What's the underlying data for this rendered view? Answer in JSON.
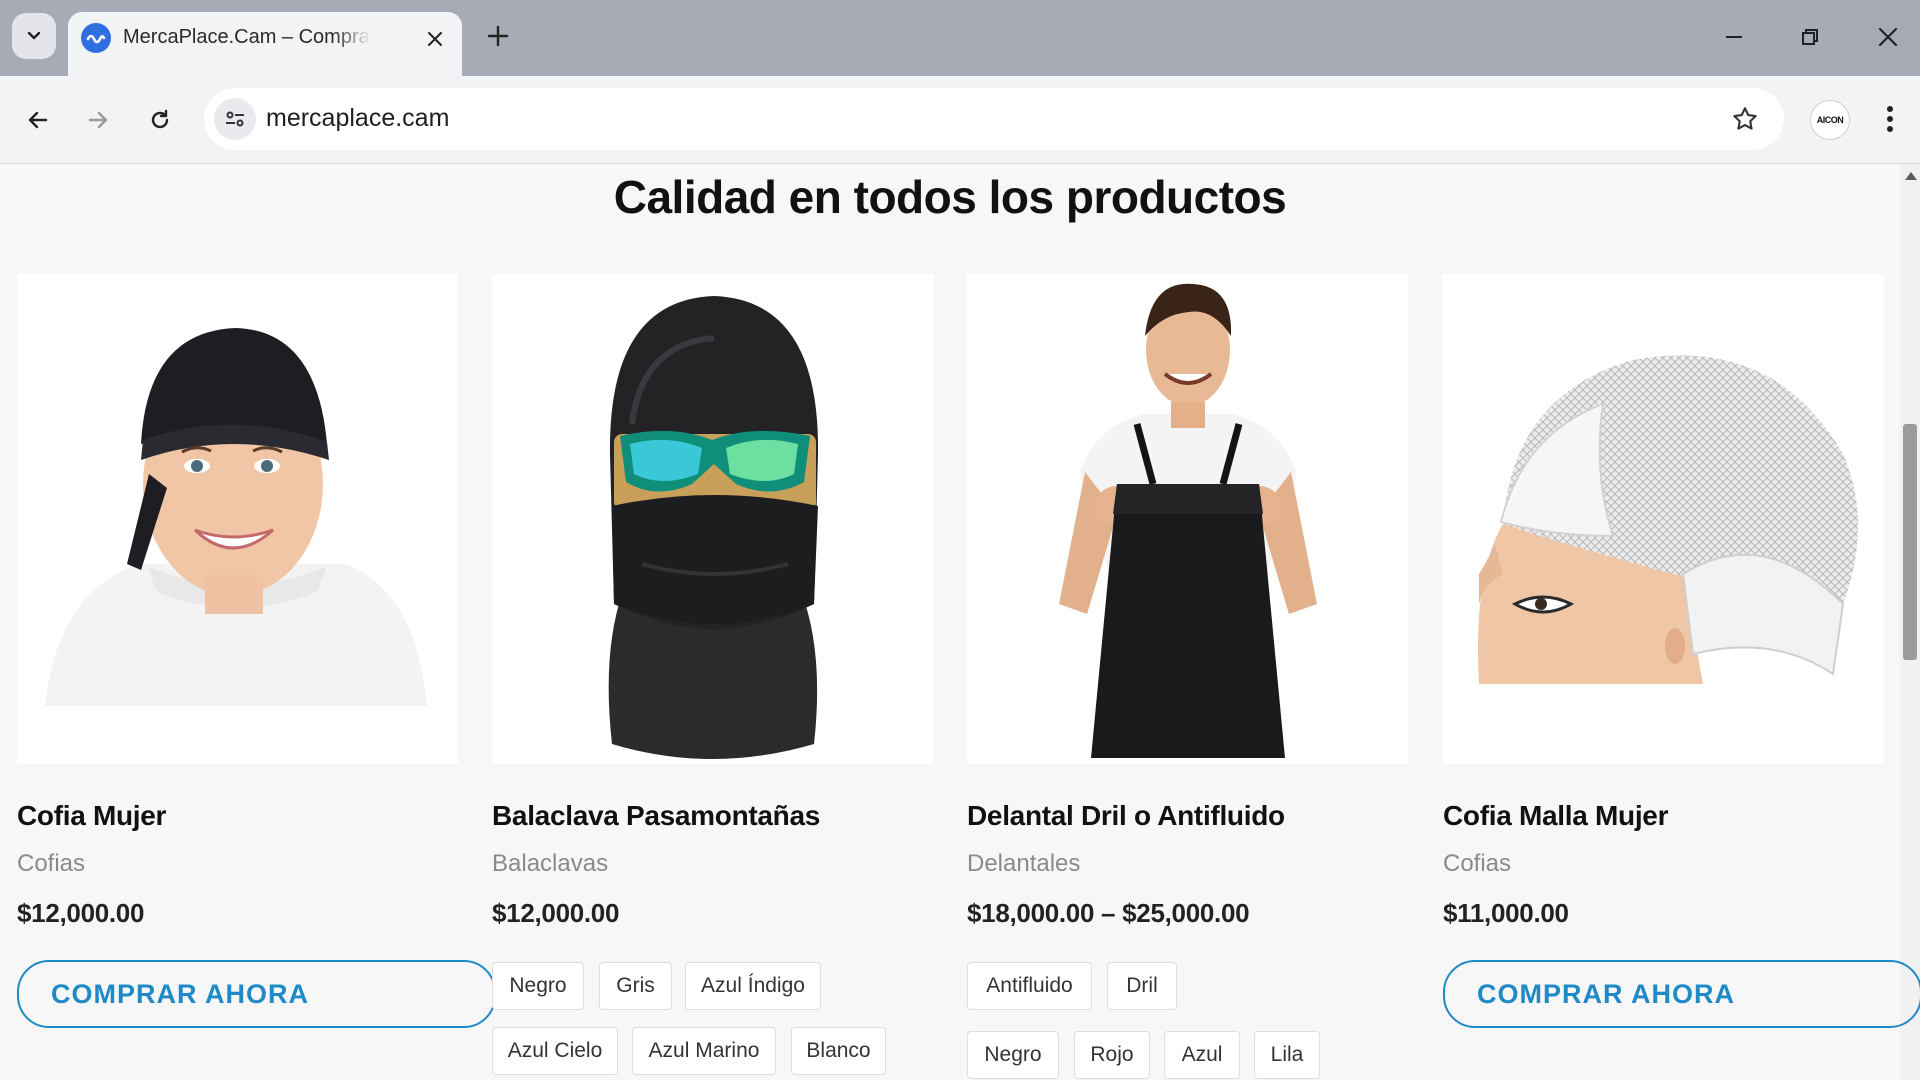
{
  "browser": {
    "tab_title": "MercaPlace.Cam – Compra con un",
    "url": "mercaplace.cam",
    "profile_label": "AICON"
  },
  "page": {
    "heading": "Calidad en todos los productos",
    "products": [
      {
        "name": "Cofia Mujer",
        "category": "Cofias",
        "price": "$12,000.00",
        "cta": "COMPRAR AHORA"
      },
      {
        "name": "Balaclava Pasamontañas",
        "category": "Balaclavas",
        "price": "$12,000.00",
        "options": [
          "Negro",
          "Gris",
          "Azul Índigo",
          "Azul Cielo",
          "Azul Marino",
          "Blanco"
        ]
      },
      {
        "name": "Delantal Dril o Antifluido",
        "category": "Delantales",
        "price": "$18,000.00 – $25,000.00",
        "materials": [
          "Antifluido",
          "Dril"
        ],
        "colors": [
          "Negro",
          "Rojo",
          "Azul",
          "Lila"
        ]
      },
      {
        "name": "Cofia Malla Mujer",
        "category": "Cofias",
        "price": "$11,000.00",
        "cta": "COMPRAR AHORA"
      }
    ]
  },
  "colors": {
    "accent": "#1f8ac6",
    "tab_strip": "#a8abb6",
    "page_bg": "#f7f7f8"
  }
}
